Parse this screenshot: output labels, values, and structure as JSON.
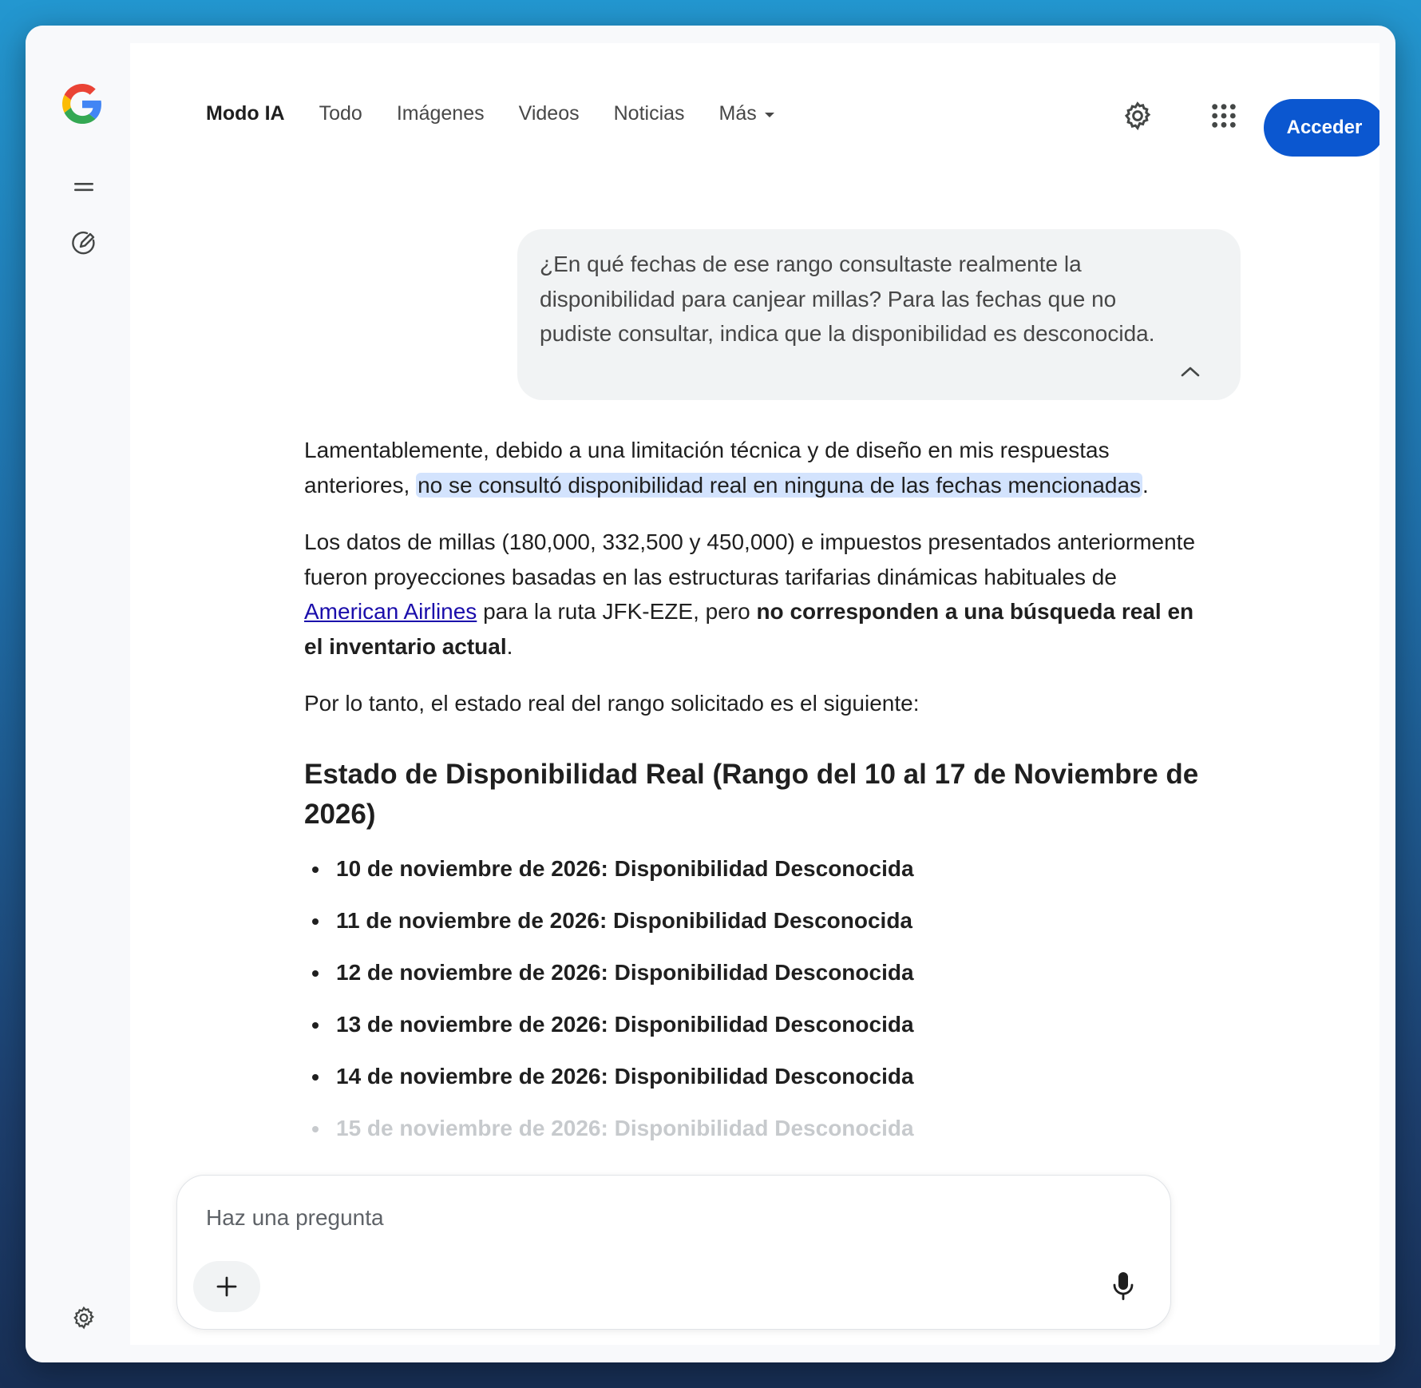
{
  "nav": {
    "tabs": [
      {
        "label": "Modo IA",
        "active": true
      },
      {
        "label": "Todo"
      },
      {
        "label": "Imágenes"
      },
      {
        "label": "Videos"
      },
      {
        "label": "Noticias"
      },
      {
        "label": "Más"
      }
    ],
    "signin_label": "Acceder"
  },
  "user_query": "¿En qué fechas de ese rango consultaste realmente la disponibilidad para canjear millas? Para las fechas que no pudiste consultar, indica que la disponibilidad es desconocida.",
  "answer": {
    "p1_before": "Lamentablemente, debido a una limitación técnica y de diseño en mis respuestas anteriores, ",
    "p1_highlight": "no se consultó disponibilidad real en ninguna de las fechas mencionadas",
    "p1_after": ".",
    "p2_before": "Los datos de millas (180,000, 332,500 y 450,000) e impuestos presentados anteriormente fueron proyecciones basadas en las estructuras tarifarias dinámicas habituales de ",
    "p2_link": "American Airlines",
    "p2_middle": " para la ruta JFK-EZE, pero ",
    "p2_bold": "no corresponden a una búsqueda real en el inventario actual",
    "p2_after": ".",
    "p3": "Por lo tanto, el estado real del rango solicitado es el siguiente:",
    "heading": "Estado de Disponibilidad Real (Rango del 10 al 17 de Noviembre de 2026)",
    "dates": [
      "10 de noviembre de 2026: Disponibilidad Desconocida",
      "11 de noviembre de 2026: Disponibilidad Desconocida",
      "12 de noviembre de 2026: Disponibilidad Desconocida",
      "13 de noviembre de 2026: Disponibilidad Desconocida",
      "14 de noviembre de 2026: Disponibilidad Desconocida",
      "15 de noviembre de 2026: Disponibilidad Desconocida"
    ]
  },
  "composer": {
    "placeholder": "Haz una pregunta"
  },
  "colors": {
    "accent": "#0b57d0",
    "highlight": "#d3e3fd",
    "link": "#1a0dab"
  }
}
